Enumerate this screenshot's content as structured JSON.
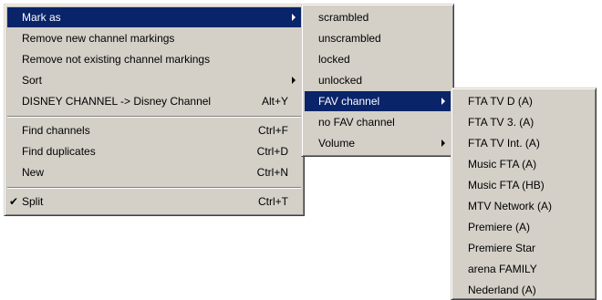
{
  "main_menu": {
    "items": [
      {
        "label": "Mark as",
        "shortcut": "",
        "submenu": true,
        "checked": false,
        "highlighted": true
      },
      {
        "label": "Remove new channel markings",
        "shortcut": "",
        "submenu": false,
        "checked": false,
        "highlighted": false
      },
      {
        "label": "Remove not existing channel markings",
        "shortcut": "",
        "submenu": false,
        "checked": false,
        "highlighted": false
      },
      {
        "label": "Sort",
        "shortcut": "",
        "submenu": true,
        "checked": false,
        "highlighted": false
      },
      {
        "label": "DISNEY CHANNEL -> Disney Channel",
        "shortcut": "Alt+Y",
        "submenu": false,
        "checked": false,
        "highlighted": false
      },
      {
        "label": "Find channels",
        "shortcut": "Ctrl+F",
        "submenu": false,
        "checked": false,
        "highlighted": false
      },
      {
        "label": "Find duplicates",
        "shortcut": "Ctrl+D",
        "submenu": false,
        "checked": false,
        "highlighted": false
      },
      {
        "label": "New",
        "shortcut": "Ctrl+N",
        "submenu": false,
        "checked": false,
        "highlighted": false
      },
      {
        "label": "Split",
        "shortcut": "Ctrl+T",
        "submenu": false,
        "checked": true,
        "highlighted": false
      }
    ]
  },
  "mark_as_menu": {
    "items": [
      {
        "label": "scrambled",
        "submenu": false,
        "highlighted": false
      },
      {
        "label": "unscrambled",
        "submenu": false,
        "highlighted": false
      },
      {
        "label": "locked",
        "submenu": false,
        "highlighted": false
      },
      {
        "label": "unlocked",
        "submenu": false,
        "highlighted": false
      },
      {
        "label": "FAV channel",
        "submenu": true,
        "highlighted": true
      },
      {
        "label": "no FAV channel",
        "submenu": false,
        "highlighted": false
      },
      {
        "label": "Volume",
        "submenu": true,
        "highlighted": false
      }
    ]
  },
  "fav_menu": {
    "items": [
      {
        "label": "FTA TV D (A)"
      },
      {
        "label": "FTA TV 3. (A)"
      },
      {
        "label": "FTA TV Int. (A)"
      },
      {
        "label": "Music FTA (A)"
      },
      {
        "label": "Music FTA (HB)"
      },
      {
        "label": "MTV Network (A)"
      },
      {
        "label": "Premiere (A)"
      },
      {
        "label": "Premiere Star"
      },
      {
        "label": "arena FAMILY"
      },
      {
        "label": "Nederland (A)"
      }
    ]
  },
  "colors": {
    "menu_background": "#d4d0c8",
    "highlight": "#0a246a",
    "highlight_text": "#ffffff"
  }
}
